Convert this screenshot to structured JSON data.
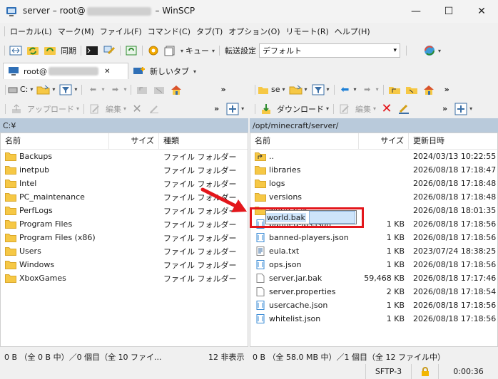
{
  "titlebar": {
    "prefix": "server – root@",
    "suffix": " – WinSCP",
    "minimize": "—",
    "maximize": "☐",
    "close": "✕"
  },
  "menubar": {
    "items": [
      "ローカル(L)",
      "マーク(M)",
      "ファイル(F)",
      "コマンド(C)",
      "タブ(T)",
      "オプション(O)",
      "リモート(R)",
      "ヘルプ(H)"
    ]
  },
  "toolbar": {
    "sync_label": "同期",
    "queue_label": "キュー",
    "transfer_settings_label": "転送設定",
    "transfer_preset": "デフォルト"
  },
  "tabs": {
    "session_tab": "root@",
    "session_close": "✕",
    "new_tab": "新しいタブ"
  },
  "left": {
    "drive": "C:",
    "upload_label": "アップロード",
    "edit_label": "編集",
    "path": "C:¥",
    "columns": {
      "name": "名前",
      "size": "サイズ",
      "type": "種類"
    },
    "files": [
      {
        "name": "Backups",
        "type": "ファイル フォルダー"
      },
      {
        "name": "inetpub",
        "type": "ファイル フォルダー"
      },
      {
        "name": "Intel",
        "type": "ファイル フォルダー"
      },
      {
        "name": "PC_maintenance",
        "type": "ファイル フォルダー"
      },
      {
        "name": "PerfLogs",
        "type": "ファイル フォルダー"
      },
      {
        "name": "Program Files",
        "type": "ファイル フォルダー"
      },
      {
        "name": "Program Files (x86)",
        "type": "ファイル フォルダー"
      },
      {
        "name": "Users",
        "type": "ファイル フォルダー"
      },
      {
        "name": "Windows",
        "type": "ファイル フォルダー"
      },
      {
        "name": "XboxGames",
        "type": "ファイル フォルダー"
      }
    ],
    "status_left": "0 B （全 0 B 中）／0 個目（全 10 ファイ...",
    "status_right": "12 非表示"
  },
  "right": {
    "drive": "se",
    "download_label": "ダウンロード",
    "edit_label": "編集",
    "path": "/opt/minecraft/server/",
    "columns": {
      "name": "名前",
      "size": "サイズ",
      "modified": "更新日時"
    },
    "files": [
      {
        "name": "..",
        "size": "",
        "modified": "2024/03/13 10:22:55",
        "icon": "parent"
      },
      {
        "name": "libraries",
        "size": "",
        "modified": "2026/08/18 17:18:47",
        "icon": "folder"
      },
      {
        "name": "logs",
        "size": "",
        "modified": "2026/08/18 17:18:48",
        "icon": "folder"
      },
      {
        "name": "versions",
        "size": "",
        "modified": "2026/08/18 17:18:48",
        "icon": "folder"
      },
      {
        "name": "world.bak",
        "size": "",
        "modified": "2026/08/18 18:01:35",
        "icon": "folder"
      },
      {
        "name": "banned-ips.json",
        "size": "1 KB",
        "modified": "2026/08/18 17:18:56",
        "icon": "json"
      },
      {
        "name": "banned-players.json",
        "size": "1 KB",
        "modified": "2026/08/18 17:18:56",
        "icon": "json"
      },
      {
        "name": "eula.txt",
        "size": "1 KB",
        "modified": "2023/07/24 18:38:25",
        "icon": "txt"
      },
      {
        "name": "ops.json",
        "size": "1 KB",
        "modified": "2026/08/18 17:18:56",
        "icon": "json"
      },
      {
        "name": "server.jar.bak",
        "size": "59,468 KB",
        "modified": "2026/08/18 17:17:46",
        "icon": "file"
      },
      {
        "name": "server.properties",
        "size": "2 KB",
        "modified": "2026/08/18 17:18:54",
        "icon": "file"
      },
      {
        "name": "usercache.json",
        "size": "1 KB",
        "modified": "2026/08/18 17:18:56",
        "icon": "json"
      },
      {
        "name": "whitelist.json",
        "size": "1 KB",
        "modified": "2026/08/18 17:18:56",
        "icon": "json"
      }
    ],
    "rename_value": "world.bak",
    "status_left": "0 B （全 58.0 MB 中）／1 個目（全 12 ファイル中）"
  },
  "bottombar": {
    "protocol": "SFTP-3",
    "time": "0:00:36"
  },
  "colors": {
    "path_bar": "#b9cadb",
    "highlight": "#e3161b",
    "folder": "#f6c845"
  }
}
